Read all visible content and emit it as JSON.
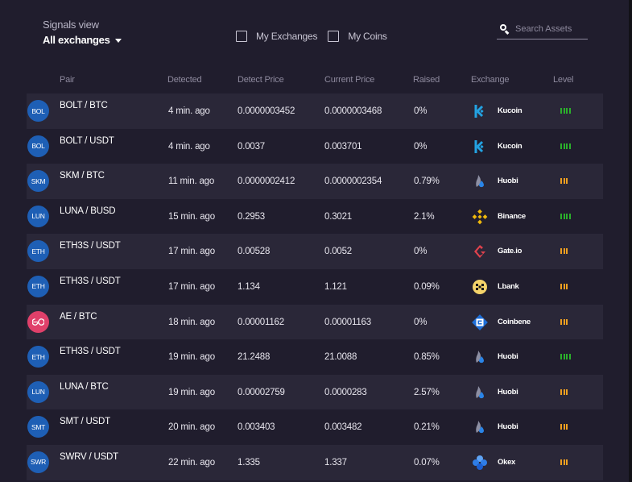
{
  "header": {
    "signals_label": "Signals view",
    "exchange_select": {
      "value": "All exchanges",
      "icon": "caret-down-icon"
    },
    "filters": [
      {
        "label": "My Exchanges",
        "checked": false
      },
      {
        "label": "My Coins",
        "checked": false
      }
    ],
    "search": {
      "placeholder": "Search Assets",
      "value": "",
      "icon": "search-icon"
    }
  },
  "table": {
    "columns": [
      "Pair",
      "Detected",
      "Detect Price",
      "Current Price",
      "Raised",
      "Exchange",
      "Level"
    ],
    "rows": [
      {
        "avatar": "BOL",
        "pair": "BOLT / BTC",
        "detected": "4 min. ago",
        "detect_price": "0.0000003452",
        "current_price": "0.0000003468",
        "raised": "0%",
        "exchange": "Kucoin",
        "exchange_icon": "kucoin-icon",
        "level": 4,
        "level_color": "green"
      },
      {
        "avatar": "BOL",
        "pair": "BOLT / USDT",
        "detected": "4 min. ago",
        "detect_price": "0.0037",
        "current_price": "0.003701",
        "raised": "0%",
        "exchange": "Kucoin",
        "exchange_icon": "kucoin-icon",
        "level": 4,
        "level_color": "green"
      },
      {
        "avatar": "SKM",
        "pair": "SKM / BTC",
        "detected": "11 min. ago",
        "detect_price": "0.0000002412",
        "current_price": "0.0000002354",
        "raised": "0.79%",
        "exchange": "Huobi",
        "exchange_icon": "huobi-icon",
        "level": 3,
        "level_color": "orange"
      },
      {
        "avatar": "LUN",
        "pair": "LUNA / BUSD",
        "detected": "15 min. ago",
        "detect_price": "0.2953",
        "current_price": "0.3021",
        "raised": "2.1%",
        "exchange": "Binance",
        "exchange_icon": "binance-icon",
        "level": 4,
        "level_color": "green"
      },
      {
        "avatar": "ETH",
        "pair": "ETH3S / USDT",
        "detected": "17 min. ago",
        "detect_price": "0.00528",
        "current_price": "0.0052",
        "raised": "0%",
        "exchange": "Gate.io",
        "exchange_icon": "gateio-icon",
        "level": 3,
        "level_color": "orange"
      },
      {
        "avatar": "ETH",
        "pair": "ETH3S / USDT",
        "detected": "17 min. ago",
        "detect_price": "1.134",
        "current_price": "1.121",
        "raised": "0.09%",
        "exchange": "Lbank",
        "exchange_icon": "lbank-icon",
        "level": 3,
        "level_color": "orange"
      },
      {
        "avatar": "∞",
        "avatar_icon": "aeternity-icon",
        "pair": "AE / BTC",
        "detected": "18 min. ago",
        "detect_price": "0.00001162",
        "current_price": "0.00001163",
        "raised": "0%",
        "exchange": "Coinbene",
        "exchange_icon": "coinbene-icon",
        "level": 3,
        "level_color": "orange"
      },
      {
        "avatar": "ETH",
        "pair": "ETH3S / USDT",
        "detected": "19 min. ago",
        "detect_price": "21.2488",
        "current_price": "21.0088",
        "raised": "0.85%",
        "exchange": "Huobi",
        "exchange_icon": "huobi-icon",
        "level": 4,
        "level_color": "green"
      },
      {
        "avatar": "LUN",
        "pair": "LUNA / BTC",
        "detected": "19 min. ago",
        "detect_price": "0.00002759",
        "current_price": "0.0000283",
        "raised": "2.57%",
        "exchange": "Huobi",
        "exchange_icon": "huobi-icon",
        "level": 3,
        "level_color": "orange"
      },
      {
        "avatar": "SMT",
        "pair": "SMT / USDT",
        "detected": "20 min. ago",
        "detect_price": "0.003403",
        "current_price": "0.003482",
        "raised": "0.21%",
        "exchange": "Huobi",
        "exchange_icon": "huobi-icon",
        "level": 3,
        "level_color": "orange"
      },
      {
        "avatar": "SWR",
        "pair": "SWRV / USDT",
        "detected": "22 min. ago",
        "detect_price": "1.335",
        "current_price": "1.337",
        "raised": "0.07%",
        "exchange": "Okex",
        "exchange_icon": "okex-icon",
        "level": 3,
        "level_color": "orange"
      }
    ]
  },
  "colors": {
    "background": "#201d2d",
    "row_alt": "#2a2738",
    "avatar_blue": "#1e5fb5",
    "avatar_ae": "#e0406a",
    "level_green": "#2bb02b",
    "level_orange": "#f0a020"
  }
}
